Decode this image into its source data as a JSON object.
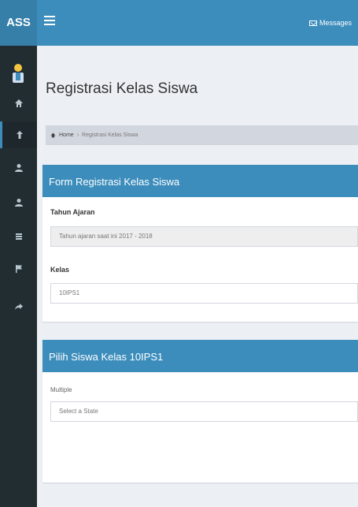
{
  "header": {
    "logo": "ASS",
    "messages_label": "Messages"
  },
  "page": {
    "title": "Registrasi Kelas Siswa"
  },
  "breadcrumb": {
    "home": "Home",
    "sep": "›",
    "current": "Registrasi Kelas Siswa"
  },
  "form_box": {
    "title": "Form Registrasi Kelas Siswa",
    "tahun_label": "Tahun Ajaran",
    "tahun_value": "Tahun ajaran saat ini 2017 - 2018",
    "kelas_label": "Kelas",
    "kelas_value": "10IPS1"
  },
  "pilih_box": {
    "title": "Pilih Siswa Kelas 10IPS1",
    "multiple_label": "Multiple",
    "select_placeholder": "Select a State"
  },
  "sidebar": {
    "items": [
      "home-icon",
      "upload-icon",
      "users-icon",
      "users-icon",
      "list-icon",
      "flag-icon",
      "share-icon"
    ]
  },
  "colors": {
    "primary": "#3c8dbc",
    "sidebar": "#222d32",
    "background": "#ecf0f5"
  }
}
